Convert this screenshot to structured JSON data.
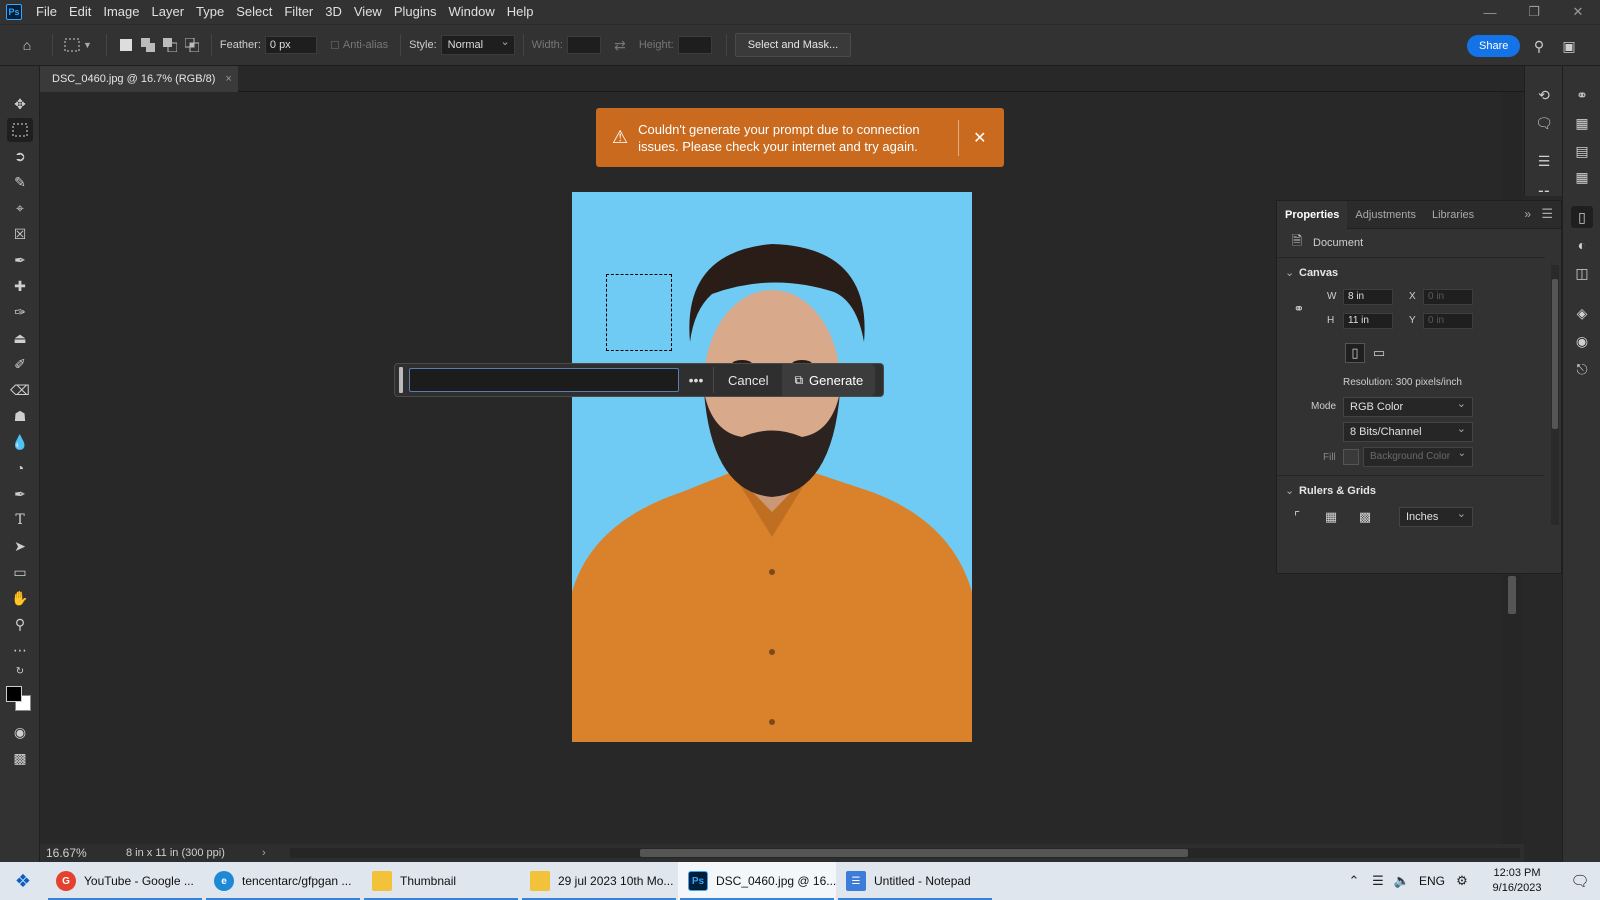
{
  "menu": [
    "File",
    "Edit",
    "Image",
    "Layer",
    "Type",
    "Select",
    "Filter",
    "3D",
    "View",
    "Plugins",
    "Window",
    "Help"
  ],
  "options": {
    "feather_label": "Feather:",
    "feather_value": "0 px",
    "antialias_label": "Anti-alias",
    "style_label": "Style:",
    "style_value": "Normal",
    "width_label": "Width:",
    "height_label": "Height:",
    "select_mask_label": "Select and Mask...",
    "share_label": "Share"
  },
  "document_tab": {
    "title": "DSC_0460.jpg @ 16.7% (RGB/8)",
    "close": "×"
  },
  "toast": {
    "message": "Couldn't generate your prompt due to connection issues. Please check your internet and try again.",
    "close": "✕"
  },
  "prompt_bar": {
    "input_value": "",
    "more": "•••",
    "cancel_label": "Cancel",
    "generate_label": "Generate"
  },
  "status": {
    "zoom": "16.67%",
    "doc_size": "8 in x 11 in (300 ppi)"
  },
  "properties": {
    "tabs": [
      "Properties",
      "Adjustments",
      "Libraries"
    ],
    "document_label": "Document",
    "canvas_label": "Canvas",
    "w_label": "W",
    "w_value": "8 in",
    "h_label": "H",
    "h_value": "11 in",
    "x_label": "X",
    "x_placeholder": "0 in",
    "y_label": "Y",
    "y_placeholder": "0 in",
    "resolution": "Resolution: 300 pixels/inch",
    "mode_label": "Mode",
    "mode_value": "RGB Color",
    "bits_value": "8 Bits/Channel",
    "fill_label": "Fill",
    "fill_value": "Background Color",
    "rulers_label": "Rulers & Grids",
    "units_value": "Inches"
  },
  "taskbar": {
    "items": [
      {
        "label": "YouTube - Google ...",
        "icon": "chrome-icon",
        "color": "#e5412f"
      },
      {
        "label": "tencentarc/gfpgan ...",
        "icon": "edge-icon",
        "color": "#1e8ad6"
      },
      {
        "label": "Thumbnail",
        "icon": "folder-icon",
        "color": "#f2c23a"
      },
      {
        "label": "29 jul 2023 10th Mo...",
        "icon": "folder-icon",
        "color": "#f2c23a"
      },
      {
        "label": "DSC_0460.jpg @ 16....",
        "icon": "photoshop-icon",
        "color": "#001e36"
      },
      {
        "label": "Untitled - Notepad",
        "icon": "notepad-icon",
        "color": "#3b7dd8"
      }
    ],
    "language": "ENG",
    "time": "12:03 PM",
    "date": "9/16/2023"
  },
  "colors": {
    "toast_bg": "#c96a1e",
    "share_bg": "#1473e6",
    "photo_bg": "#6fcbf4",
    "shirt": "#d9822b"
  }
}
